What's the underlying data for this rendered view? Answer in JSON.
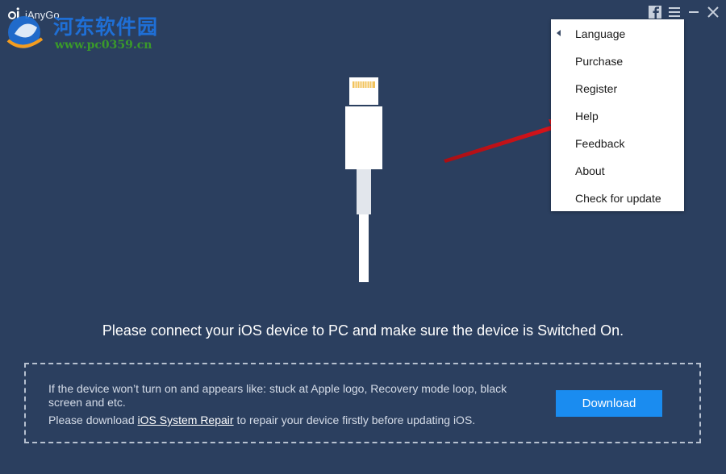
{
  "app": {
    "title": "iAnyGo"
  },
  "watermark": {
    "title": "河东软件园",
    "url": "www.pc0359.cn"
  },
  "window_controls": [
    "facebook-icon",
    "menu-icon",
    "minimize-icon",
    "close-icon"
  ],
  "menu": {
    "items": [
      {
        "label": "Language",
        "has_submenu": true
      },
      {
        "label": "Purchase"
      },
      {
        "label": "Register"
      },
      {
        "label": "Help"
      },
      {
        "label": "Feedback"
      },
      {
        "label": "About"
      },
      {
        "label": "Check for update"
      }
    ]
  },
  "main": {
    "message": "Please connect your iOS device to PC and make sure the device is Switched On.",
    "info_text": "If the device won’t turn on and appears like: stuck at Apple logo, Recovery mode loop, black screen and etc.",
    "download_prefix": "Please download ",
    "download_link": "iOS System Repair",
    "download_suffix": " to repair your device firstly before updating iOS.",
    "download_button": "Download"
  },
  "colors": {
    "background": "#2b3f5f",
    "accent": "#1a8cf0",
    "annotation_arrow": "#e0141b"
  }
}
